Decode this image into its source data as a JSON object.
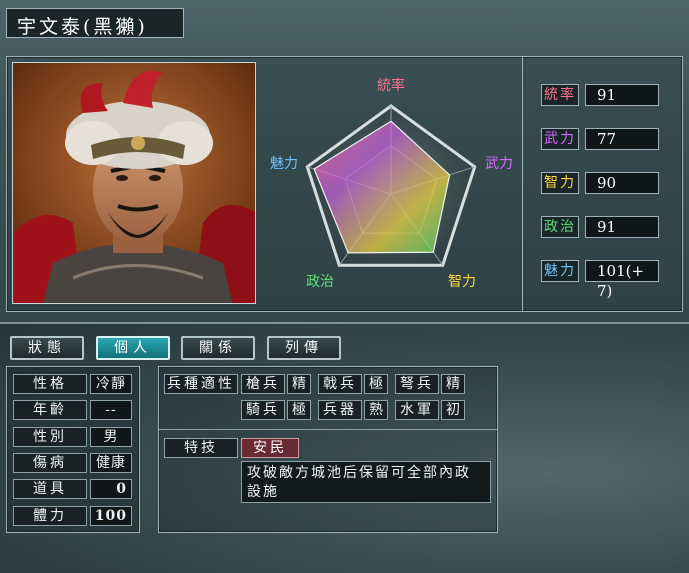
{
  "general": {
    "name": "宇文泰(黑獺)"
  },
  "radar": {
    "labels": {
      "leadership": "統率",
      "war": "武力",
      "intelligence": "智力",
      "politics": "政治",
      "charisma": "魅力"
    },
    "values": {
      "leadership": 91,
      "war": 77,
      "intelligence": 90,
      "politics": 91,
      "charisma": 101
    },
    "colors": {
      "leadership": "#ff6f8f",
      "war": "#d36bff",
      "intelligence": "#ffd640",
      "politics": "#5ee07a",
      "charisma": "#6fc0ff"
    }
  },
  "stats": [
    {
      "label": "統率",
      "value": "91",
      "color": "#ff6f8f"
    },
    {
      "label": "武力",
      "value": "77",
      "color": "#d36bff"
    },
    {
      "label": "智力",
      "value": "90",
      "color": "#ffd640"
    },
    {
      "label": "政治",
      "value": "91",
      "color": "#5ee07a"
    },
    {
      "label": "魅力",
      "value": "101(+ 7)",
      "color": "#6fc0ff"
    }
  ],
  "tabs": [
    "狀態",
    "個人",
    "關係",
    "列傳"
  ],
  "active_tab": "個人",
  "personal": [
    {
      "label": "性格",
      "value": "冷靜"
    },
    {
      "label": "年齡",
      "value": "--"
    },
    {
      "label": "性別",
      "value": "男"
    },
    {
      "label": "傷病",
      "value": "健康"
    },
    {
      "label": "道具",
      "value": "0"
    },
    {
      "label": "體力",
      "value": "100"
    }
  ],
  "aptitude": {
    "title": "兵種適性",
    "rows": [
      [
        {
          "type": "槍兵",
          "rank": "精"
        },
        {
          "type": "戟兵",
          "rank": "極"
        },
        {
          "type": "弩兵",
          "rank": "精"
        }
      ],
      [
        {
          "type": "騎兵",
          "rank": "極"
        },
        {
          "type": "兵器",
          "rank": "熟"
        },
        {
          "type": "水軍",
          "rank": "初"
        }
      ]
    ]
  },
  "skill": {
    "label": "特技",
    "name": "安民",
    "description": "攻破敵方城池后保留可全部內政設施"
  }
}
